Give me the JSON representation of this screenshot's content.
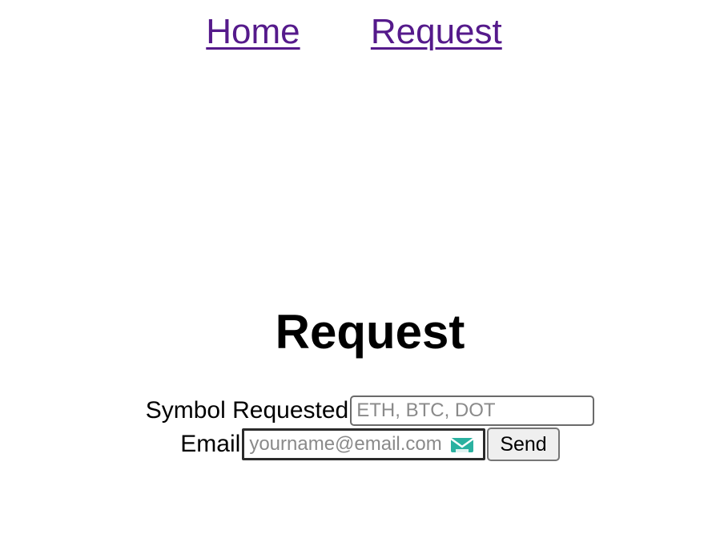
{
  "nav": {
    "home_label": "Home",
    "request_label": "Request",
    "link_color": "#551a8b"
  },
  "main": {
    "title": "Request"
  },
  "form": {
    "symbol_label": "Symbol Requested",
    "symbol_placeholder": "ETH, BTC, DOT",
    "email_label": "Email",
    "email_placeholder": "yourname@email.com",
    "email_extension_icon": "tempmail-icon",
    "send_label": "Send"
  }
}
